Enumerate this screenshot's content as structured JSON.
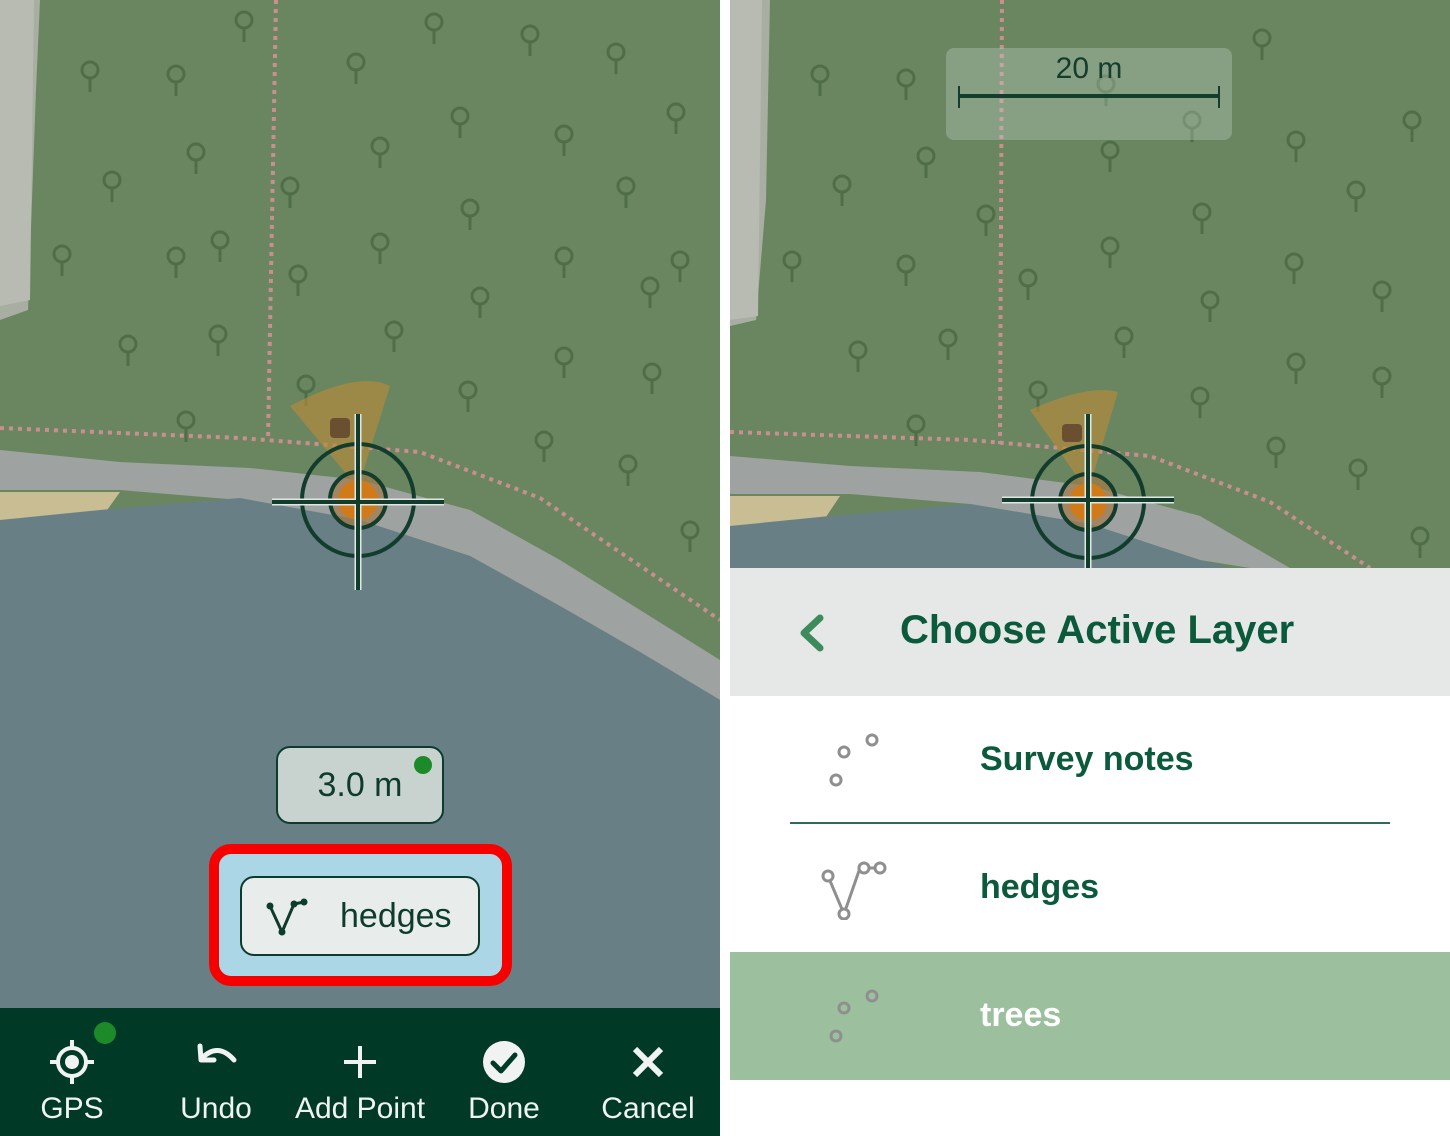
{
  "left_screen": {
    "accuracy": {
      "value": "3.0 m"
    },
    "active_layer_chip": {
      "label": "hedges",
      "icon": "line-layer-icon"
    },
    "toolbar": {
      "items": [
        {
          "label": "GPS",
          "icon": "gps-target-icon"
        },
        {
          "label": "Undo",
          "icon": "undo-icon"
        },
        {
          "label": "Add Point",
          "icon": "plus-icon"
        },
        {
          "label": "Done",
          "icon": "check-circle-icon"
        },
        {
          "label": "Cancel",
          "icon": "close-icon"
        }
      ]
    },
    "colors": {
      "highlight": "#f60000",
      "toolbar_bg": "#003a27",
      "gps_status": "#1d8a2a"
    }
  },
  "right_screen": {
    "scale_bar": {
      "label": "20 m"
    },
    "sheet": {
      "title": "Choose Active Layer",
      "back_icon": "chevron-left-icon",
      "layers": [
        {
          "label": "Survey notes",
          "icon": "point-layer-icon",
          "selected": false
        },
        {
          "label": "hedges",
          "icon": "line-layer-icon",
          "selected": false
        },
        {
          "label": "trees",
          "icon": "point-layer-icon",
          "selected": true
        }
      ]
    },
    "colors": {
      "title": "#0b5a3c",
      "selected_row": "#9cc09e",
      "header_bg": "#e6e7e7"
    }
  }
}
